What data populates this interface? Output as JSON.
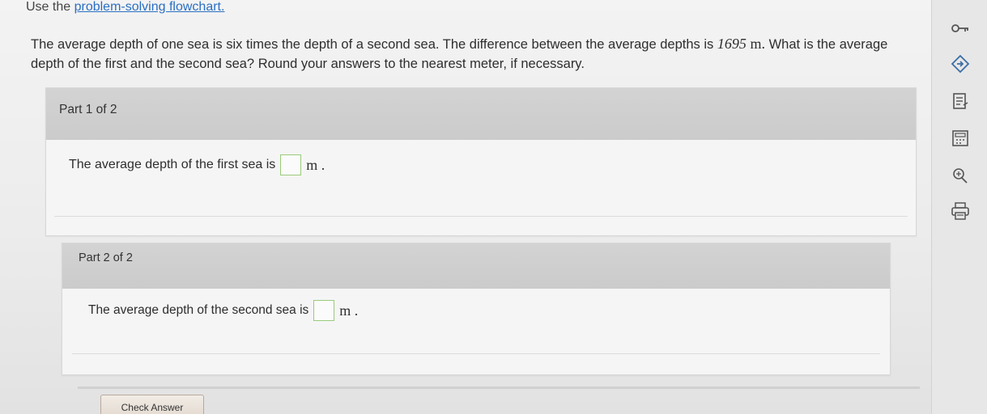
{
  "instruction": {
    "prefix": "Use the",
    "link_text": "problem-solving flowchart."
  },
  "problem": {
    "text_before": "The average depth of one sea is six times the depth of a second sea. The difference between the average depths is",
    "value": "1695",
    "unit": "m.",
    "text_after": "What is the average depth of the first and the second sea? Round your answers to the nearest meter, if necessary."
  },
  "parts": [
    {
      "label": "Part 1 of 2",
      "prompt": "The average depth of the first sea is",
      "input_value": "",
      "unit": "m ."
    },
    {
      "label": "Part 2 of 2",
      "prompt": "The average depth of the second sea is",
      "input_value": "",
      "unit": "m ."
    }
  ],
  "check_button_label": "Check Answer",
  "toolbar": {
    "icons": [
      "key-icon",
      "play-arrow-icon",
      "notes-icon",
      "calculator-icon",
      "formula-icon",
      "print-icon"
    ]
  },
  "colors": {
    "link": "#2b6fc2",
    "answer_box_border": "#9acb7a",
    "part_header": "#cbcbcb"
  }
}
